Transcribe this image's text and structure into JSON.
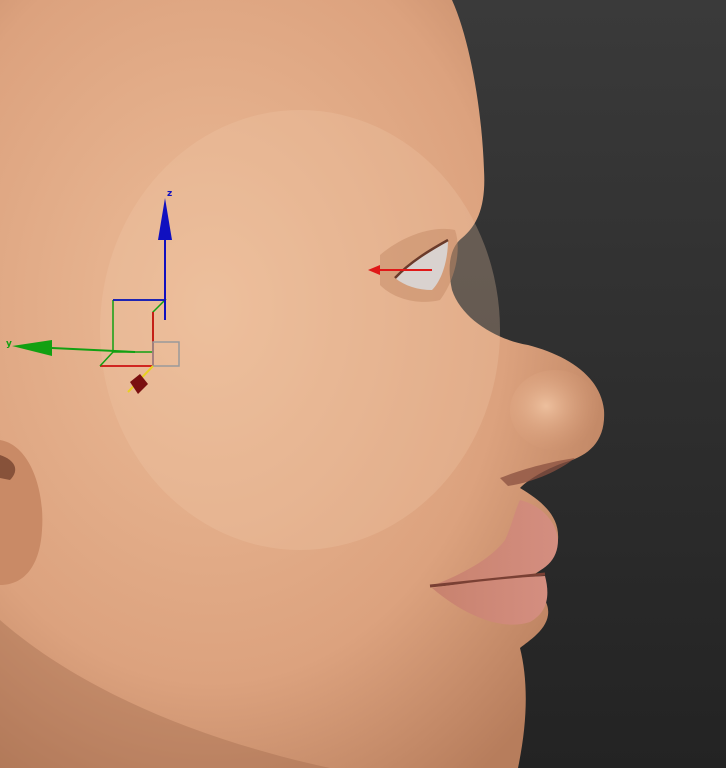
{
  "viewport": {
    "background_top": "#3a3a3a",
    "background_bottom": "#232323"
  },
  "model": {
    "skin_light": "#ecbc98",
    "skin_mid": "#dca27e",
    "skin_shadow": "#b77d5c",
    "lip_color": "#d48e80",
    "eye_white": "#d9d2cf"
  },
  "gizmo": {
    "x_color": "#cc1010",
    "y_color": "#12a012",
    "z_color": "#1010c0",
    "plane_color": "#9a9a9a",
    "handle_color": "#7a1010",
    "handle_tip_color": "#e8d020",
    "labels": {
      "z": "z",
      "y": "y"
    }
  },
  "target_arrow": {
    "color": "#e01818"
  }
}
